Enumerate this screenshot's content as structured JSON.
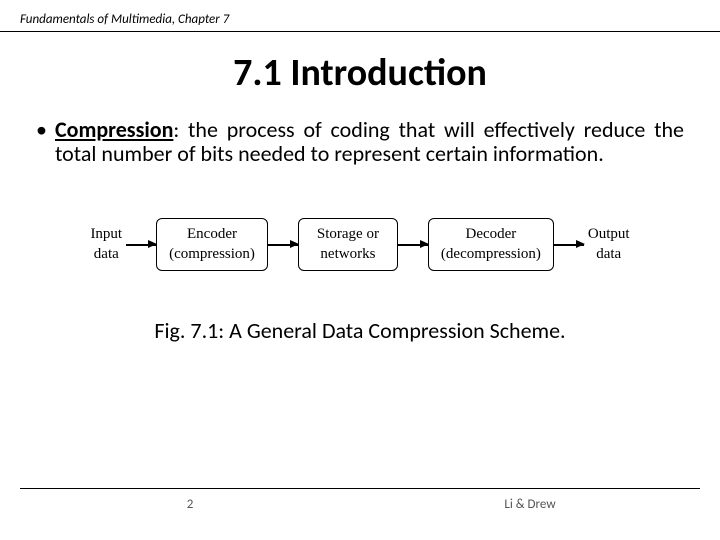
{
  "header": "Fundamentals of Multimedia, Chapter 7",
  "title": "7.1 Introduction",
  "term": "Compression",
  "definition": ": the process of coding that will effectively reduce the total number of bits needed to represent certain information.",
  "diagram": {
    "input_top": "Input",
    "input_bottom": "data",
    "encoder_top": "Encoder",
    "encoder_bottom": "(compression)",
    "storage_top": "Storage or",
    "storage_bottom": "networks",
    "decoder_top": "Decoder",
    "decoder_bottom": "(decompression)",
    "output_top": "Output",
    "output_bottom": "data"
  },
  "caption": "Fig. 7.1: A General Data Compression Scheme.",
  "page_number": "2",
  "authors": "Li & Drew"
}
